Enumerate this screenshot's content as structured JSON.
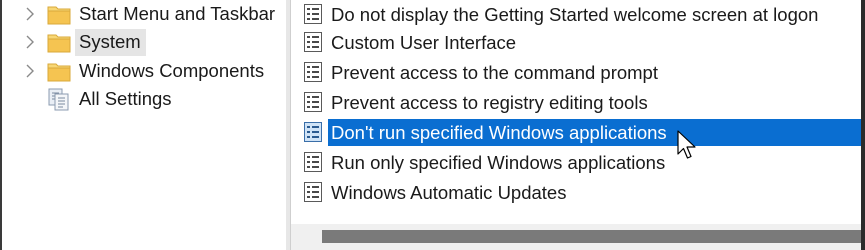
{
  "tree": {
    "items": [
      {
        "label": "Start Menu and Taskbar",
        "icon": "folder-icon",
        "expandable": true,
        "selected": false
      },
      {
        "label": "System",
        "icon": "folder-icon",
        "expandable": true,
        "selected": true
      },
      {
        "label": "Windows Components",
        "icon": "folder-icon",
        "expandable": true,
        "selected": false
      },
      {
        "label": "All Settings",
        "icon": "settings-list-icon",
        "expandable": false,
        "selected": false
      }
    ]
  },
  "list": {
    "items": [
      {
        "label": "Do not display the Getting Started welcome screen at logon",
        "icon": "policy-setting-icon",
        "selected": false
      },
      {
        "label": "Custom User Interface",
        "icon": "policy-setting-icon",
        "selected": false
      },
      {
        "label": "Prevent access to the command prompt",
        "icon": "policy-setting-icon",
        "selected": false
      },
      {
        "label": "Prevent access to registry editing tools",
        "icon": "policy-setting-icon",
        "selected": false
      },
      {
        "label": "Don't run specified Windows applications",
        "icon": "policy-setting-icon",
        "selected": true
      },
      {
        "label": "Run only specified Windows applications",
        "icon": "policy-setting-icon",
        "selected": false
      },
      {
        "label": "Windows Automatic Updates",
        "icon": "policy-setting-icon",
        "selected": false
      }
    ]
  },
  "colors": {
    "selection": "#0a6ed1",
    "tree_selection": "#e5e5e5",
    "folder": "#f5c451"
  }
}
